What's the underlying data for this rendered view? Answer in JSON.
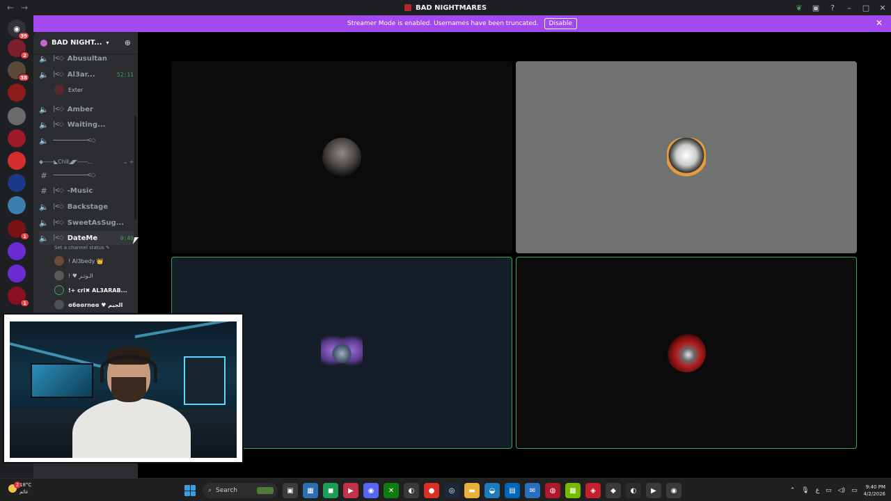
{
  "window": {
    "title": "BAD NIGHTMARES"
  },
  "banner": {
    "text": "Streamer Mode is enabled. Usernames have been truncated.",
    "button": "Disable"
  },
  "rail": {
    "home_badge": "39",
    "servers": [
      {
        "name": "server-1",
        "color": "#7a1f2b",
        "badge": "2"
      },
      {
        "name": "server-2",
        "color": "#5a4a3a",
        "badge": "38"
      },
      {
        "name": "server-3",
        "color": "#8a1c1c",
        "badge": ""
      },
      {
        "name": "server-4",
        "color": "#6b6b6b",
        "badge": ""
      },
      {
        "name": "server-5",
        "color": "#9b1b2b",
        "badge": ""
      },
      {
        "name": "server-6",
        "color": "#d32f2f",
        "badge": ""
      },
      {
        "name": "server-7",
        "color": "#1c3a8a",
        "badge": ""
      },
      {
        "name": "server-8",
        "color": "#3a7fb0",
        "badge": ""
      },
      {
        "name": "server-9",
        "color": "#7a1414",
        "badge": "1"
      },
      {
        "name": "server-10",
        "color": "#6a2bd0",
        "badge": ""
      },
      {
        "name": "server-11",
        "color": "#6a2bd0",
        "badge": ""
      },
      {
        "name": "server-12",
        "color": "#8a0f1f",
        "badge": "1"
      }
    ]
  },
  "sidebar": {
    "guild_name": "BAD NIGHT...",
    "channels": [
      {
        "label": "Abusultan",
        "icon": "speaker",
        "deco": "|<◇",
        "timer": ""
      },
      {
        "label": "Al3ar...",
        "icon": "speaker-live",
        "deco": "|<◇",
        "timer": "52:11"
      },
      {
        "label": "Amber",
        "icon": "speaker",
        "deco": "|<◇",
        "timer": ""
      },
      {
        "label": "Waiting...",
        "icon": "speaker",
        "deco": "|<◇",
        "timer": ""
      },
      {
        "label": "",
        "icon": "speaker",
        "deco": "——————<◇",
        "timer": ""
      },
      {
        "label": "",
        "icon": "hash",
        "deco": "——————<◇",
        "timer": ""
      },
      {
        "label": "-Music",
        "icon": "hash",
        "deco": "|<◇",
        "timer": ""
      },
      {
        "label": "Backstage",
        "icon": "speaker",
        "deco": "|<◇",
        "timer": ""
      },
      {
        "label": "SweetAsSug...",
        "icon": "speaker",
        "deco": "|<◇",
        "timer": ""
      },
      {
        "label": "DateMe",
        "icon": "speaker-live",
        "deco": "|<◇",
        "timer": "0:49"
      }
    ],
    "al3ar_member": "Exter",
    "category": "◆——◣Chill◢◤——...",
    "status_hint": "Set a channel status ✎",
    "members": [
      {
        "name": "! Al3bedy 👑"
      },
      {
        "name": "! ♥ الـوتـر"
      },
      {
        "name": "!+ cri✖ AL3ARAB..."
      },
      {
        "name": "ɞ6ɞɞrnɞɞ ♥ ﺍﻟﺠﻴﻢ"
      }
    ]
  },
  "taskbar": {
    "weather_temp": "18°C",
    "weather_sub": "غائم",
    "weather_badge": "2",
    "search": "Search",
    "apps": [
      {
        "name": "file-explorer",
        "color": "#3c3c3c",
        "glyph": "▣"
      },
      {
        "name": "photos",
        "color": "#2f6fb0",
        "glyph": "▦"
      },
      {
        "name": "android-app",
        "color": "#1d9e57",
        "glyph": "◼"
      },
      {
        "name": "red-app",
        "color": "#c4314b",
        "glyph": "▶"
      },
      {
        "name": "discord",
        "color": "#5865f2",
        "glyph": "◉"
      },
      {
        "name": "xbox",
        "color": "#107c10",
        "glyph": "✕"
      },
      {
        "name": "obs",
        "color": "#3a3a3a",
        "glyph": "◐"
      },
      {
        "name": "chrome",
        "color": "#d93025",
        "glyph": "●"
      },
      {
        "name": "steam",
        "color": "#1b2838",
        "glyph": "◎"
      },
      {
        "name": "folder",
        "color": "#e8b23a",
        "glyph": "▬"
      },
      {
        "name": "edge",
        "color": "#1e7ab8",
        "glyph": "◒"
      },
      {
        "name": "store",
        "color": "#0067b8",
        "glyph": "▤"
      },
      {
        "name": "mail",
        "color": "#2a6fbd",
        "glyph": "✉"
      },
      {
        "name": "red-circle-app",
        "color": "#b0182b",
        "glyph": "◍"
      },
      {
        "name": "nvidia",
        "color": "#76b900",
        "glyph": "▩"
      },
      {
        "name": "vpn",
        "color": "#c4202d",
        "glyph": "◈"
      },
      {
        "name": "circle-app",
        "color": "#3a3a3a",
        "glyph": "◆"
      },
      {
        "name": "github",
        "color": "#2d2d2d",
        "glyph": "◐"
      },
      {
        "name": "green-app",
        "color": "#3a3a3a",
        "glyph": "▶"
      },
      {
        "name": "shell-app",
        "color": "#3a3a3a",
        "glyph": "◉"
      }
    ],
    "lang": "ع",
    "time": "9:40 PM",
    "date": "4/2/2026"
  }
}
